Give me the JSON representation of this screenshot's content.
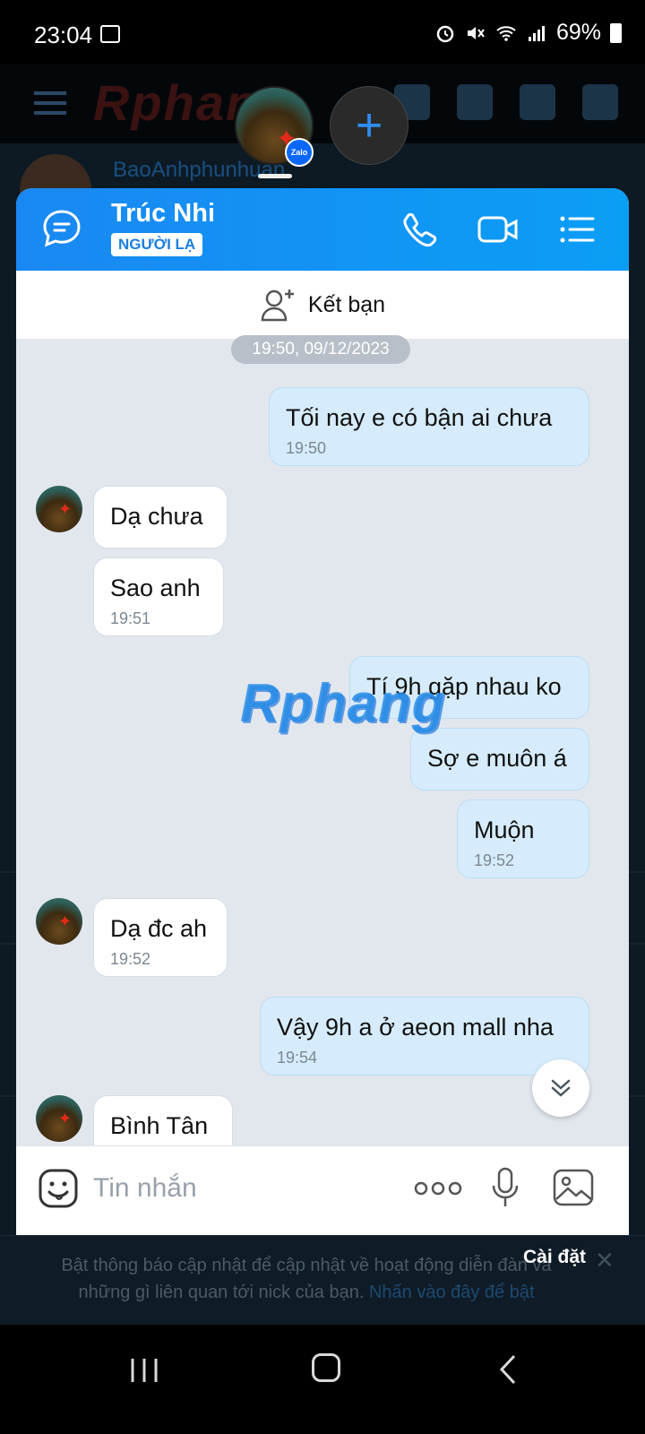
{
  "status_bar": {
    "time": "23:04",
    "battery": "69%",
    "icons": [
      "gallery-icon",
      "alarm-icon",
      "mute-icon",
      "wifi-icon",
      "signal-icon",
      "battery-icon"
    ]
  },
  "background_app": {
    "logo": "Rphang",
    "username": "BaoAnhphunhuan"
  },
  "chat": {
    "contact_name": "Trúc Nhi",
    "contact_badge": "NGƯỜI LẠ",
    "add_friend_label": "Kết bạn",
    "date_separator": "19:50, 09/12/2023",
    "messages": [
      {
        "direction": "out",
        "text": "Tối nay e có bận ai chưa",
        "time": "19:50"
      },
      {
        "direction": "in",
        "text": "Dạ chưa",
        "time": ""
      },
      {
        "direction": "in",
        "text": "Sao anh",
        "time": "19:51"
      },
      {
        "direction": "out",
        "text": "Tí 9h gặp nhau ko",
        "time": ""
      },
      {
        "direction": "out",
        "text": "Sợ e muôn á",
        "time": ""
      },
      {
        "direction": "out",
        "text": "Muộn",
        "time": "19:52"
      },
      {
        "direction": "in",
        "text": "Dạ đc ah",
        "time": "19:52"
      },
      {
        "direction": "out",
        "text": "Vậy 9h a ở aeon mall nha",
        "time": "19:54"
      },
      {
        "direction": "in",
        "text": "Bình Tân",
        "time": ""
      }
    ],
    "input_placeholder": "Tin nhắn",
    "watermark": "Rphang"
  },
  "head_badge": "Zalo",
  "notification": {
    "text": "Bật thông báo cập nhật để cập nhật về hoạt động diễn đàn và những gì liên quan tới nick của bạn.",
    "link": "Nhấn vào đây để bật",
    "settings": "Cài đặt",
    "close": "✕"
  },
  "colors": {
    "header_blue": "#1a88f2",
    "outgoing_bubble": "#d6ecfc",
    "chat_background": "#e2e7ee"
  }
}
